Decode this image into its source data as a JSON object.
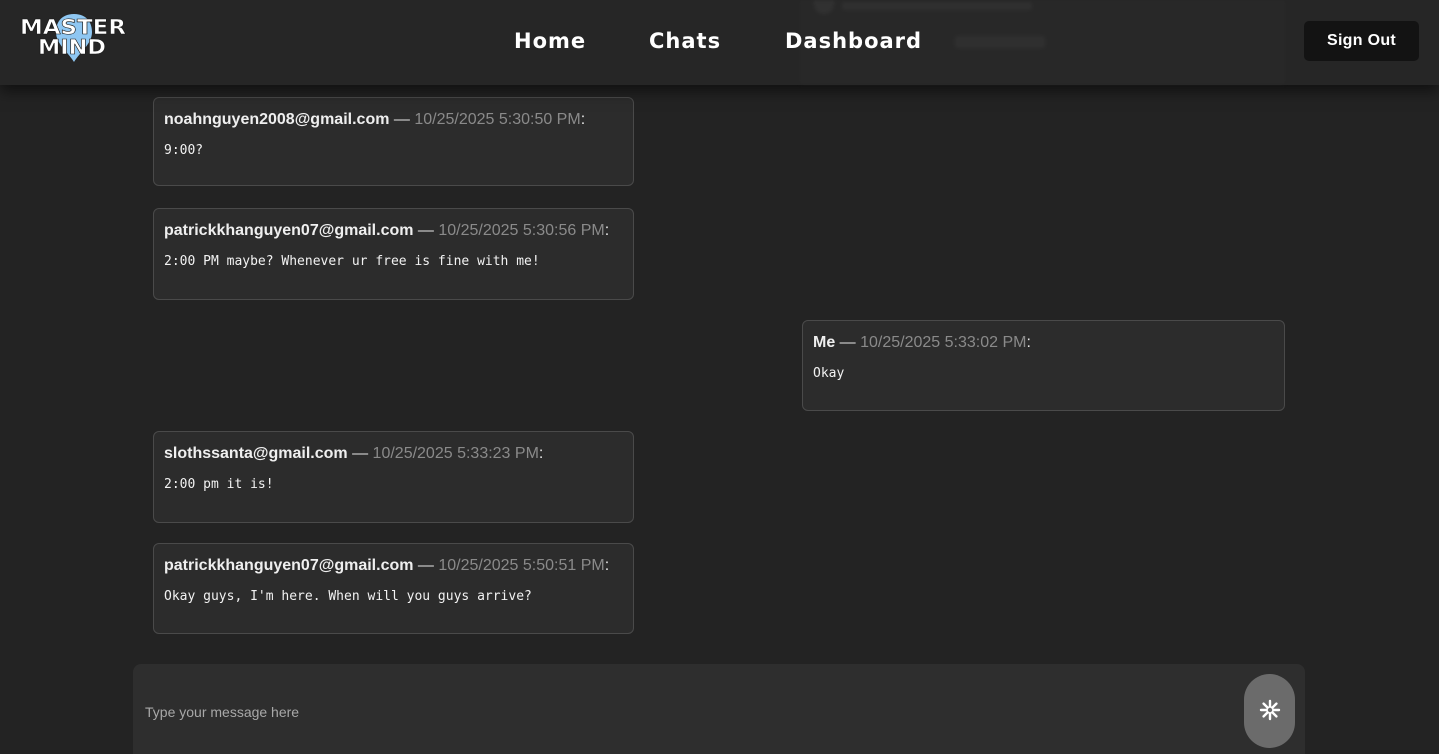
{
  "header": {
    "logo_text_line1": "MASTER",
    "logo_text_line2": "MIND",
    "nav": {
      "home": "Home",
      "chats": "Chats",
      "dashboard": "Dashboard"
    },
    "sign_out_label": "Sign Out"
  },
  "messages": [
    {
      "author": "noahnguyen2008@gmail.com",
      "separator": " — ",
      "timestamp": "10/25/2025 5:30:50 PM",
      "suffix": ":",
      "text": "9:00?",
      "side": "left"
    },
    {
      "author": "patrickkhanguyen07@gmail.com",
      "separator": " — ",
      "timestamp": "10/25/2025 5:30:56 PM",
      "suffix": ":",
      "text": "2:00 PM maybe? Whenever ur free is fine with me!",
      "side": "left"
    },
    {
      "author": "Me",
      "separator": " — ",
      "timestamp": "10/25/2025 5:33:02 PM",
      "suffix": ":",
      "text": "Okay",
      "side": "right"
    },
    {
      "author": "slothssanta@gmail.com",
      "separator": " — ",
      "timestamp": "10/25/2025 5:33:23 PM",
      "suffix": ":",
      "text": "2:00 pm it is!",
      "side": "left"
    },
    {
      "author": "patrickkhanguyen07@gmail.com",
      "separator": " — ",
      "timestamp": "10/25/2025 5:50:51 PM",
      "suffix": ":",
      "text": "Okay guys, I'm here. When will you guys arrive?",
      "side": "left"
    }
  ],
  "composer": {
    "placeholder": "Type your message here",
    "value": "",
    "send_icon": "asterisk-send-icon"
  },
  "colors": {
    "background": "#232323",
    "header": "#262626",
    "bubble": "#2c2c2c",
    "bubble_border": "#4a4a4a",
    "timestamp": "#8a8a8a",
    "logo_accent": "#8fc7f2",
    "send_button": "#6b6b6b"
  }
}
